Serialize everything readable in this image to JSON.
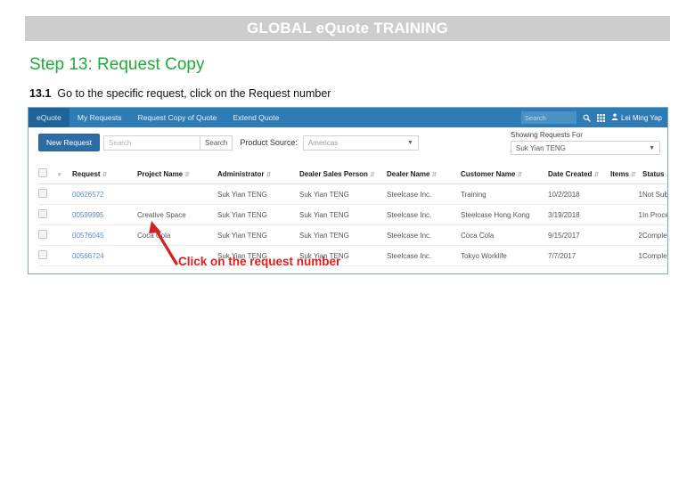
{
  "slide": {
    "banner_title": "GLOBAL eQuote TRAINING",
    "step_heading": "Step 13: Request Copy",
    "step_number": "13.1",
    "step_text": "Go to the specific request, click on the Request number",
    "annotation": "Click on the request number",
    "colors": {
      "banner_bg": "#cdcdcd",
      "banner_text": "#ffffff",
      "heading_green": "#1faa39",
      "annotation_red": "#d81f1f",
      "app_nav_blue": "#2e7bb5",
      "app_border": "#7aa9cc"
    }
  },
  "app": {
    "brand": "eQuote",
    "nav_items": [
      {
        "label": "My Requests",
        "active": true
      },
      {
        "label": "Request Copy of Quote",
        "active": false
      },
      {
        "label": "Extend Quote",
        "active": false
      }
    ],
    "nav_search_placeholder": "Search",
    "search_icon": "search-icon",
    "apps_icon": "grid-apps-icon",
    "user_icon": "person-icon",
    "user_name": "Lei Ming Yap",
    "toolbar": {
      "new_request_label": "New Request",
      "search_placeholder": "Search",
      "search_button_label": "Search",
      "product_source_label": "Product Source:",
      "product_source_value": "Americas",
      "showing_requests_label": "Showing Requests For",
      "showing_requests_value": "Suk Yian TENG"
    },
    "table": {
      "columns": [
        "Request",
        "Project Name",
        "Administrator",
        "Dealer Sales Person",
        "Dealer Name",
        "Customer Name",
        "Date Created",
        "Items",
        "Status"
      ],
      "rows": [
        {
          "request": "00626572",
          "project_name": "",
          "administrator": "Suk Yian TENG",
          "dealer_sales_person": "Suk Yian TENG",
          "dealer_name": "Steelcase Inc.",
          "customer_name": "Training",
          "date_created": "10/2/2018",
          "items": "1",
          "status": "Not Submitted",
          "status_class": "st-notsub"
        },
        {
          "request": "00599995",
          "project_name": "Creative Space",
          "administrator": "Suk Yian TENG",
          "dealer_sales_person": "Suk Yian TENG",
          "dealer_name": "Steelcase Inc.",
          "customer_name": "Steelcase Hong Kong",
          "date_created": "3/19/2018",
          "items": "1",
          "status": "In Process",
          "status_class": "st-inproc"
        },
        {
          "request": "00576045",
          "project_name": "Coca Cola",
          "administrator": "Suk Yian TENG",
          "dealer_sales_person": "Suk Yian TENG",
          "dealer_name": "Steelcase Inc.",
          "customer_name": "Coca Cola",
          "date_created": "9/15/2017",
          "items": "2",
          "status": "Completed",
          "status_class": "st-done"
        },
        {
          "request": "00566724",
          "project_name": "",
          "administrator": "Suk Yian TENG",
          "dealer_sales_person": "Suk Yian TENG",
          "dealer_name": "Steelcase Inc.",
          "customer_name": "Tokyo Worklife",
          "date_created": "7/7/2017",
          "items": "1",
          "status": "Completed",
          "status_class": "st-done"
        }
      ]
    }
  }
}
